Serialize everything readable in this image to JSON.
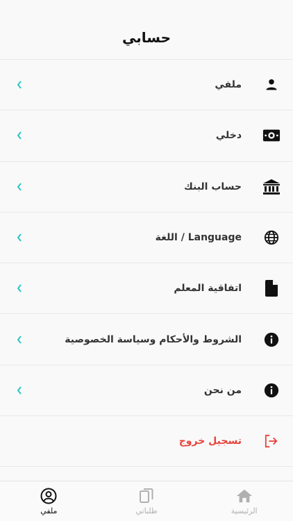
{
  "status_bar": {
    "text": ""
  },
  "header": {
    "title": "حسابي"
  },
  "menu": {
    "items": [
      {
        "label": "ملفي",
        "icon": "person-icon"
      },
      {
        "label": "دخلي",
        "icon": "money-icon"
      },
      {
        "label": "حساب البنك",
        "icon": "bank-icon"
      },
      {
        "label": "Language / اللغة",
        "icon": "globe-icon"
      },
      {
        "label": "اتفاقية المعلم",
        "icon": "document-icon"
      },
      {
        "label": "الشروط والأحكام وسياسة الخصوصية",
        "icon": "info-icon"
      },
      {
        "label": "من نحن",
        "icon": "info-icon"
      }
    ],
    "logout": {
      "label": "تسجيل خروج",
      "icon": "logout-icon"
    }
  },
  "tabbar": {
    "tabs": [
      {
        "label": "الرئيسية",
        "icon": "home-icon",
        "active": false
      },
      {
        "label": "طلباتي",
        "icon": "copy-icon",
        "active": false
      },
      {
        "label": "ملفي",
        "icon": "user-circle-icon",
        "active": true
      }
    ]
  },
  "colors": {
    "accent": "#2ec4c4",
    "logout": "#e8433a",
    "inactive_tab": "#b0b0b0",
    "background": "#f9f9f9"
  }
}
